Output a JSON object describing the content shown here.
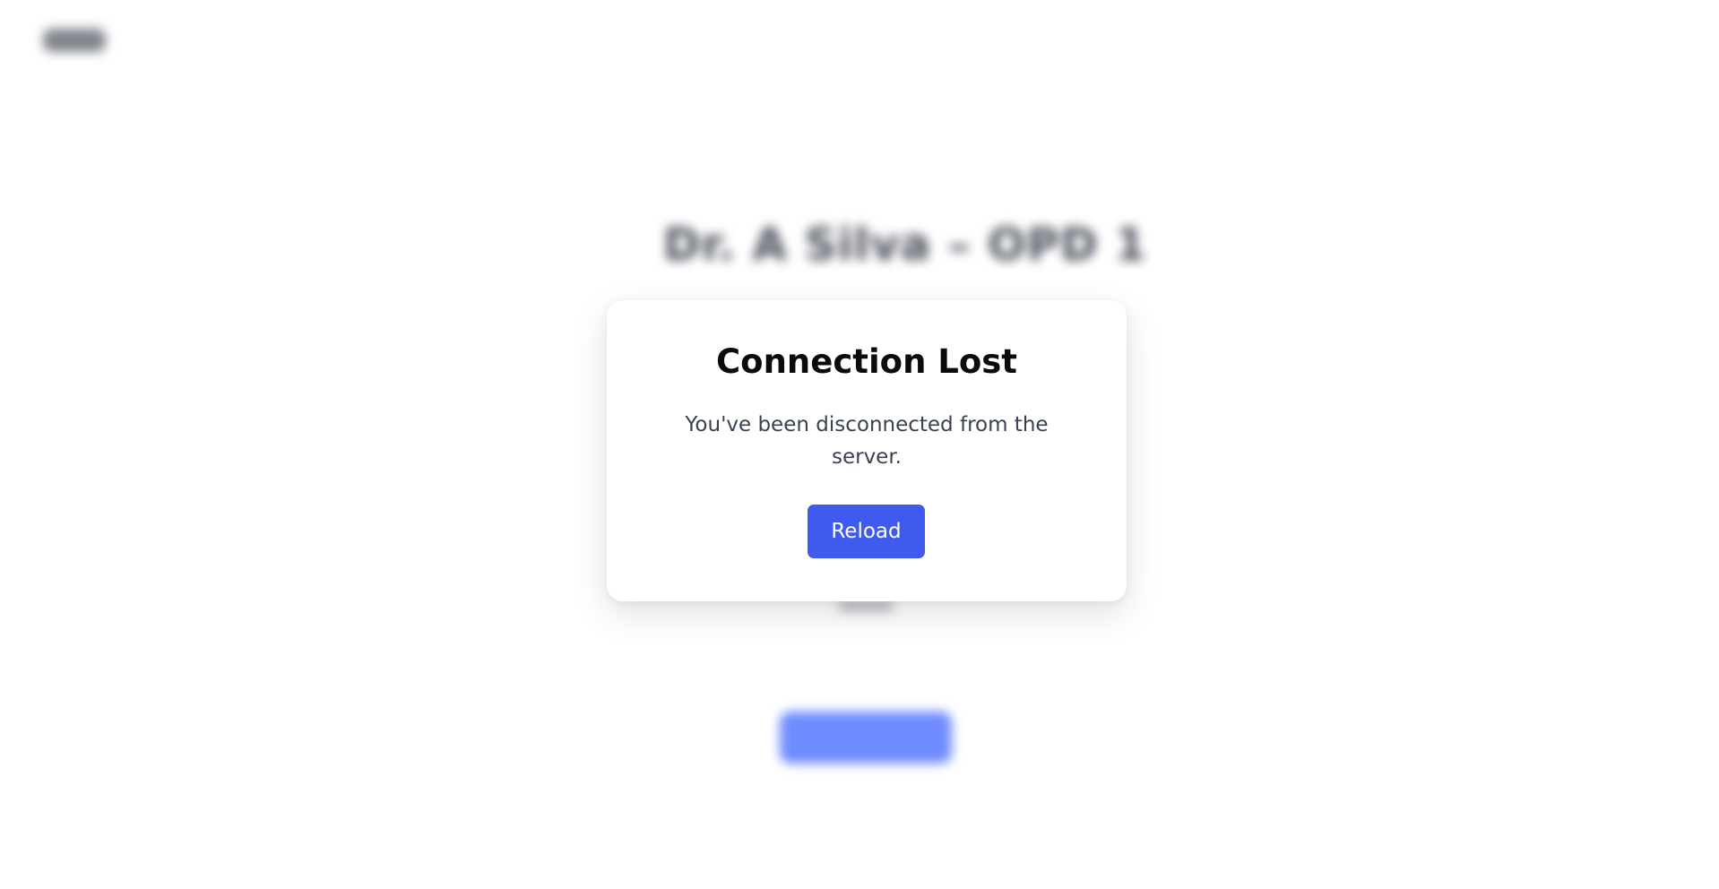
{
  "background": {
    "logo_text": "",
    "page_title": "Dr. A Silva – OPD 1",
    "small_text": "",
    "action_button_label": ""
  },
  "modal": {
    "title": "Connection Lost",
    "message": "You've been disconnected from the server.",
    "reload_label": "Reload"
  },
  "colors": {
    "primary_button": "#3f5bef",
    "title_text": "#0b0b0b",
    "message_text": "#3a4152"
  }
}
